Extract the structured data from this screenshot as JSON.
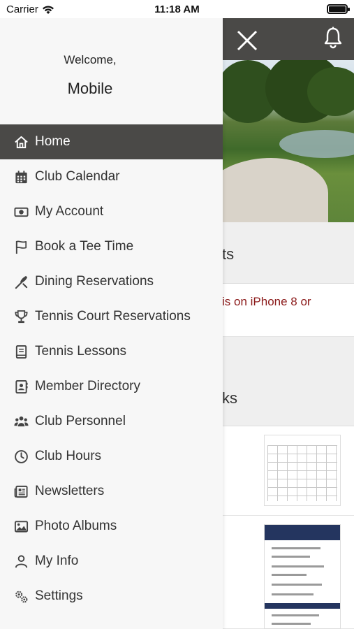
{
  "status_bar": {
    "carrier": "Carrier",
    "time": "11:18 AM"
  },
  "background": {
    "section1_partial": "ts",
    "news_partial": "is on iPhone 8 or",
    "section2_partial": "ks"
  },
  "drawer": {
    "welcome": "Welcome,",
    "username": "Mobile",
    "items": [
      {
        "label": "Home",
        "icon": "home-icon",
        "active": true
      },
      {
        "label": "Club Calendar",
        "icon": "calendar-icon"
      },
      {
        "label": "My Account",
        "icon": "money-icon"
      },
      {
        "label": "Book a Tee Time",
        "icon": "flag-icon"
      },
      {
        "label": "Dining Reservations",
        "icon": "utensils-icon"
      },
      {
        "label": "Tennis Court Reservations",
        "icon": "trophy-icon"
      },
      {
        "label": "Tennis Lessons",
        "icon": "book-icon"
      },
      {
        "label": "Member Directory",
        "icon": "contact-book-icon"
      },
      {
        "label": "Club Personnel",
        "icon": "people-icon"
      },
      {
        "label": "Club Hours",
        "icon": "clock-icon"
      },
      {
        "label": "Newsletters",
        "icon": "newspaper-icon"
      },
      {
        "label": "Photo Albums",
        "icon": "image-icon"
      },
      {
        "label": "My Info",
        "icon": "user-icon"
      },
      {
        "label": "Settings",
        "icon": "gears-icon"
      }
    ]
  },
  "colors": {
    "header_bg": "#4a4947",
    "active_item_bg": "#4a4947",
    "drawer_bg": "#f7f7f7",
    "news_text": "#8b1a1a"
  }
}
